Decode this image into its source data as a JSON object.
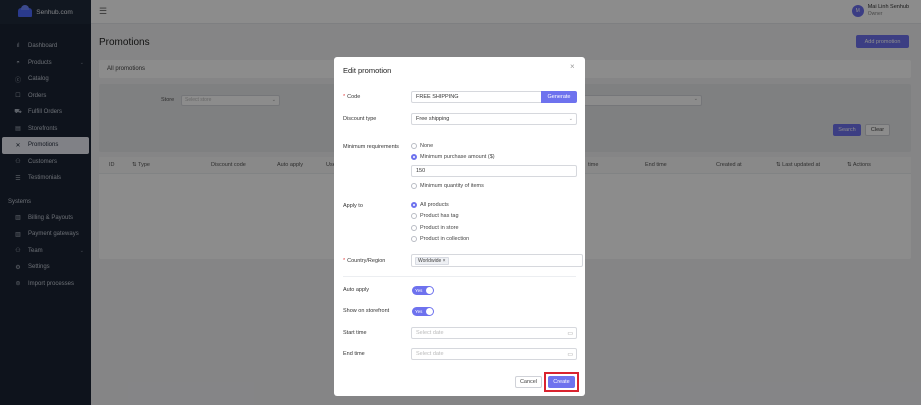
{
  "app": {
    "logo_text": "Senhub.com",
    "user": {
      "initials": "M",
      "name": "Mai Linh Senhub",
      "role": "Owner"
    }
  },
  "sidebar": {
    "items": [
      {
        "label": "Dashboard",
        "icon": "bar-chart-icon",
        "glyph": "ıl"
      },
      {
        "label": "Products",
        "icon": "box-icon",
        "glyph": "◓",
        "has_chevron": true
      },
      {
        "label": "Catalog",
        "icon": "catalog-icon",
        "glyph": "ⓒ"
      },
      {
        "label": "Orders",
        "icon": "orders-icon",
        "glyph": "☐"
      },
      {
        "label": "Fulfill Orders",
        "icon": "truck-icon",
        "glyph": "⛟"
      },
      {
        "label": "Storefronts",
        "icon": "storefront-icon",
        "glyph": "▤"
      },
      {
        "label": "Promotions",
        "icon": "promotion-icon",
        "glyph": "✕",
        "active": true
      },
      {
        "label": "Customers",
        "icon": "customers-icon",
        "glyph": "⚇"
      },
      {
        "label": "Testimonials",
        "icon": "testimonials-icon",
        "glyph": "☰"
      }
    ],
    "section_label": "Systems",
    "system_items": [
      {
        "label": "Billing & Payouts",
        "icon": "billing-icon",
        "glyph": "▥"
      },
      {
        "label": "Payment gateways",
        "icon": "payment-icon",
        "glyph": "▥"
      },
      {
        "label": "Team",
        "icon": "team-icon",
        "glyph": "⚇",
        "has_chevron": true
      },
      {
        "label": "Settings",
        "icon": "settings-icon",
        "glyph": "⚙"
      },
      {
        "label": "Import processes",
        "icon": "import-icon",
        "glyph": "⊜"
      }
    ],
    "chevron": "⌄"
  },
  "page": {
    "title": "Promotions",
    "add_button": "Add promotion",
    "tab": "All promotions",
    "filter": {
      "store_label": "Store",
      "store_placeholder": "Select store",
      "search_button": "Search",
      "clear_button": "Clear"
    },
    "table_headers": [
      "ID",
      "Type",
      "Discount code",
      "Auto apply",
      "Use",
      "time",
      "End time",
      "Created at",
      "Last updated at",
      "Actions"
    ]
  },
  "modal": {
    "title": "Edit promotion",
    "close_glyph": "×",
    "code": {
      "label": "Code",
      "value": "FREE SHIPPING",
      "generate_button": "Generate"
    },
    "discount_type": {
      "label": "Discount type",
      "value": "Free shipping"
    },
    "minimum_requirements": {
      "label": "Minimum requirements",
      "options": [
        "None",
        "Minimum purchase amount ($)",
        "Minimum quantity of items"
      ],
      "selected": 1,
      "amount_value": "150"
    },
    "apply_to": {
      "label": "Apply to",
      "options": [
        "All products",
        "Product has tag",
        "Product in store",
        "Product in collection"
      ],
      "selected": 0
    },
    "country": {
      "label": "Country/Region",
      "tag": "Worldwide",
      "tag_remove": "×"
    },
    "auto_apply": {
      "label": "Auto apply",
      "toggle_text": "Yes",
      "on": true
    },
    "show_on_storefront": {
      "label": "Show on storefront",
      "toggle_text": "Yes",
      "on": true
    },
    "start_time": {
      "label": "Start time",
      "placeholder": "Select date"
    },
    "end_time": {
      "label": "End time",
      "placeholder": "Select date"
    },
    "cancel_button": "Cancel",
    "create_button": "Create",
    "highlight_color": "#d9232f"
  },
  "colors": {
    "accent": "#6e72ee",
    "sidebar_bg": "#1b2433",
    "required": "#e23b3b"
  }
}
